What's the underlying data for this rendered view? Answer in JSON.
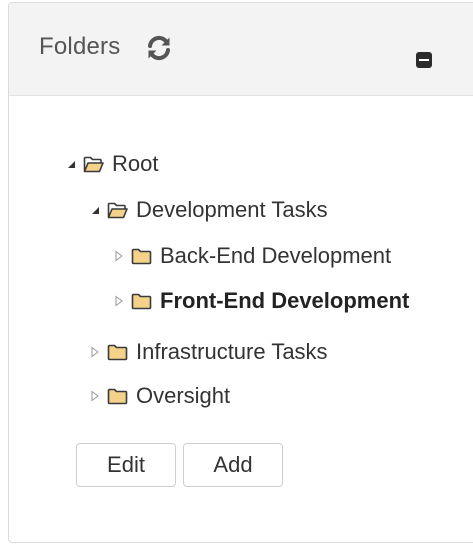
{
  "panel": {
    "title": "Folders",
    "refresh_icon": "refresh-icon",
    "collapse_icon": "minus-square-icon"
  },
  "tree": {
    "root": {
      "label": "Root",
      "state": "expanded",
      "icon": "folder-open-icon"
    },
    "development": {
      "label": "Development Tasks",
      "state": "expanded",
      "icon": "folder-open-icon"
    },
    "backend": {
      "label": "Back-End Development",
      "state": "collapsed",
      "icon": "folder-icon"
    },
    "frontend": {
      "label": "Front-End Development",
      "state": "collapsed",
      "selected": true,
      "icon": "folder-icon"
    },
    "infrastructure": {
      "label": "Infrastructure Tasks",
      "state": "collapsed",
      "icon": "folder-icon"
    },
    "oversight": {
      "label": "Oversight",
      "state": "collapsed",
      "icon": "folder-icon"
    }
  },
  "actions": {
    "edit_label": "Edit",
    "add_label": "Add"
  },
  "colors": {
    "folder_fill": "#f5d28a",
    "folder_stroke": "#3a3a3a",
    "header_bg": "#f3f3f3"
  }
}
